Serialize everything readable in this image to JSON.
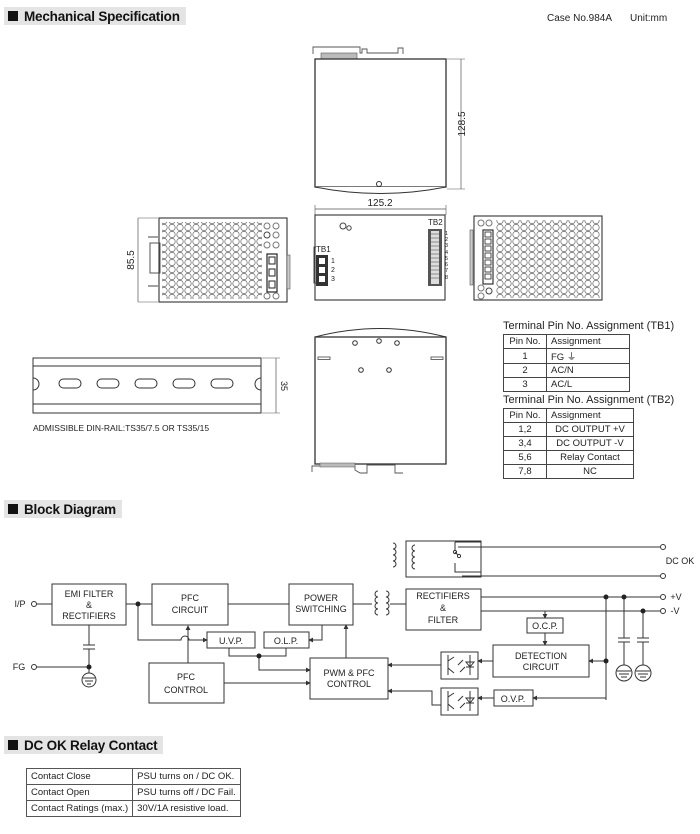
{
  "sections": {
    "mechanical": "Mechanical Specification",
    "block": "Block Diagram",
    "relay": "DC OK Relay Contact"
  },
  "case_info": {
    "case_no": "Case No.984A",
    "unit": "Unit:mm"
  },
  "dimensions": {
    "height": "128.5",
    "width": "125.2",
    "depth": "85.5",
    "rail_height": "35"
  },
  "drawing_labels": {
    "tb1": "TB1",
    "tb2": "TB2",
    "tb1_pins": [
      "1",
      "2",
      "3"
    ],
    "tb2_pins": [
      "1",
      "2",
      "3",
      "4",
      "5",
      "6",
      "7",
      "8"
    ],
    "din_rail_note": "ADMISSIBLE DIN-RAIL:TS35/7.5 OR TS35/15"
  },
  "tb1_table": {
    "title": "Terminal Pin No.  Assignment (TB1)",
    "headers": [
      "Pin No.",
      "Assignment"
    ],
    "rows": [
      [
        "1",
        "FG ⏚"
      ],
      [
        "2",
        "AC/N"
      ],
      [
        "3",
        "AC/L"
      ]
    ]
  },
  "tb2_table": {
    "title": "Terminal Pin No.  Assignment (TB2)",
    "headers": [
      "Pin No.",
      "Assignment"
    ],
    "rows": [
      [
        "1,2",
        "DC OUTPUT +V"
      ],
      [
        "3,4",
        "DC OUTPUT -V"
      ],
      [
        "5,6",
        "Relay Contact"
      ],
      [
        "7,8",
        "NC"
      ]
    ]
  },
  "block_diagram": {
    "inputs": {
      "ip": "I/P",
      "fg": "FG"
    },
    "outputs": {
      "dc_ok": "DC OK",
      "pos": "+V",
      "neg": "-V"
    },
    "blocks": {
      "emi": [
        "EMI FILTER",
        "&",
        "RECTIFIERS"
      ],
      "pfc_circuit": [
        "PFC",
        "CIRCUIT"
      ],
      "power_switching": [
        "POWER",
        "SWITCHING"
      ],
      "rectifiers": [
        "RECTIFIERS",
        "&",
        "FILTER"
      ],
      "uvp": "U.V.P.",
      "olp": "O.L.P.",
      "pfc_control": [
        "PFC",
        "CONTROL"
      ],
      "pwm": [
        "PWM & PFC",
        "CONTROL"
      ],
      "ocp": "O.C.P.",
      "detection": [
        "DETECTION",
        "CIRCUIT"
      ],
      "ovp": "O.V.P."
    }
  },
  "relay_table": {
    "rows": [
      [
        "Contact Close",
        "PSU turns on / DC OK."
      ],
      [
        "Contact Open",
        "PSU turns off / DC Fail."
      ],
      [
        "Contact Ratings (max.)",
        "30V/1A resistive load."
      ]
    ]
  }
}
